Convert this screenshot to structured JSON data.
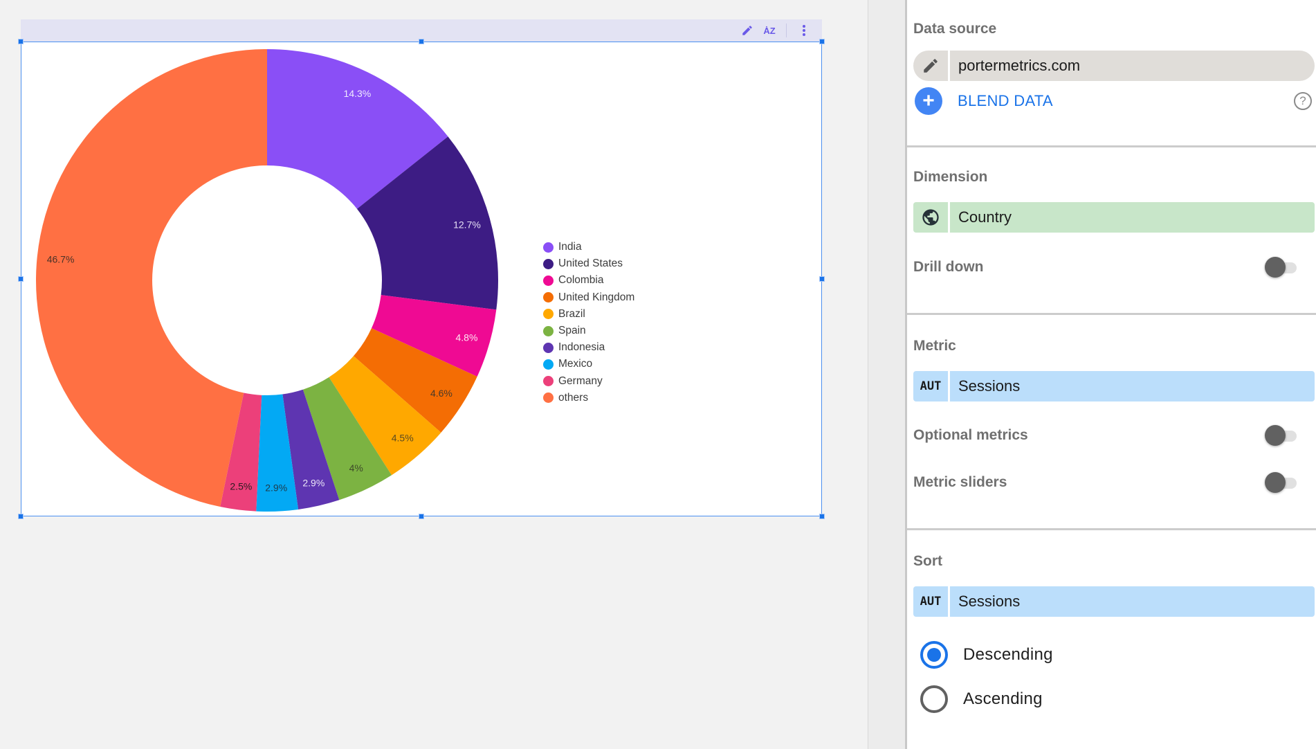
{
  "chart_toolbar": {
    "icons": [
      "pencil-edit-icon",
      "sort-az-icon",
      "more-vert-icon"
    ]
  },
  "chart_data": {
    "type": "pie",
    "variant": "donut",
    "categories": [
      "India",
      "United States",
      "Colombia",
      "United Kingdom",
      "Brazil",
      "Spain",
      "Indonesia",
      "Mexico",
      "Germany",
      "others"
    ],
    "values": [
      14.3,
      12.7,
      4.8,
      4.6,
      4.5,
      4.0,
      2.9,
      2.9,
      2.5,
      46.7
    ],
    "labels": [
      "14.3%",
      "12.7%",
      "4.8%",
      "4.6%",
      "4.5%",
      "4%",
      "2.9%",
      "2.9%",
      "2.5%",
      "46.7%"
    ],
    "colors": [
      "#8a4ff6",
      "#3d1c84",
      "#ef0a93",
      "#f46d04",
      "#ffa800",
      "#7cb342",
      "#5e35b1",
      "#03a9f4",
      "#ec407a",
      "#ff7043"
    ],
    "label_colors": [
      "#f0eaff",
      "#e6e0f5",
      "#ffe6f2",
      "#4a3a2a",
      "#5a4a20",
      "#3d4a2a",
      "#ece6f8",
      "#1e3a4a",
      "#2a1a20",
      "#4a3228"
    ],
    "legend_position": "right",
    "start_angle": "12 o'clock, clockwise",
    "unit": "Sessions (%)"
  },
  "panel": {
    "data_source": {
      "title": "Data source",
      "value": "portermetrics.com",
      "edit_icon": "pencil-icon",
      "blend_label": "BLEND DATA",
      "help_icon": "help-icon"
    },
    "dimension": {
      "title": "Dimension",
      "icon": "globe-icon",
      "value": "Country",
      "drill_down_label": "Drill down",
      "drill_down_enabled": false
    },
    "metric": {
      "title": "Metric",
      "agg": "AUT",
      "value": "Sessions",
      "optional_metrics_label": "Optional metrics",
      "optional_metrics_enabled": false,
      "metric_sliders_label": "Metric sliders",
      "metric_sliders_enabled": false
    },
    "sort": {
      "title": "Sort",
      "agg": "AUT",
      "value": "Sessions",
      "options": [
        {
          "label": "Descending",
          "selected": true
        },
        {
          "label": "Ascending",
          "selected": false
        }
      ]
    }
  }
}
